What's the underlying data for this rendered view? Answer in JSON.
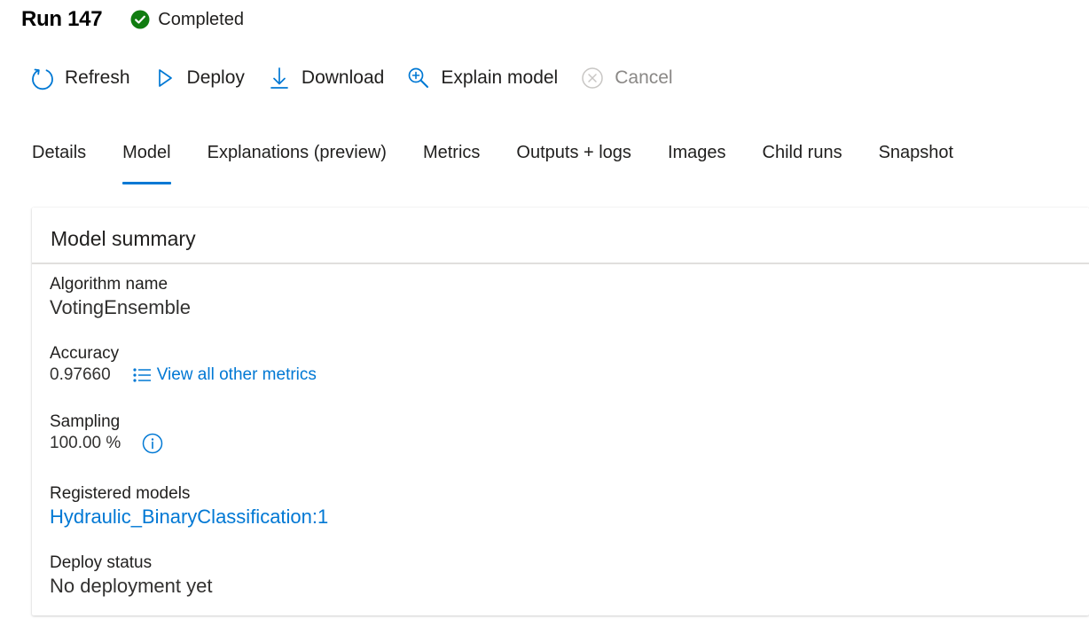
{
  "header": {
    "run_title": "Run 147",
    "status": "Completed",
    "status_color": "#107c10"
  },
  "toolbar": {
    "refresh": "Refresh",
    "deploy": "Deploy",
    "download": "Download",
    "explain": "Explain model",
    "cancel": "Cancel"
  },
  "tabs": [
    "Details",
    "Model",
    "Explanations (preview)",
    "Metrics",
    "Outputs + logs",
    "Images",
    "Child runs",
    "Snapshot"
  ],
  "active_tab": "Model",
  "accent_color": "#0078d4",
  "model_summary": {
    "title": "Model summary",
    "algorithm_label": "Algorithm name",
    "algorithm_value": "VotingEnsemble",
    "accuracy_label": "Accuracy",
    "accuracy_value": "0.97660",
    "metrics_link": "View all other metrics",
    "sampling_label": "Sampling",
    "sampling_value": "100.00 %",
    "registered_label": "Registered models",
    "registered_value": "Hydraulic_BinaryClassification:1",
    "deploy_label": "Deploy status",
    "deploy_value": "No deployment yet"
  }
}
